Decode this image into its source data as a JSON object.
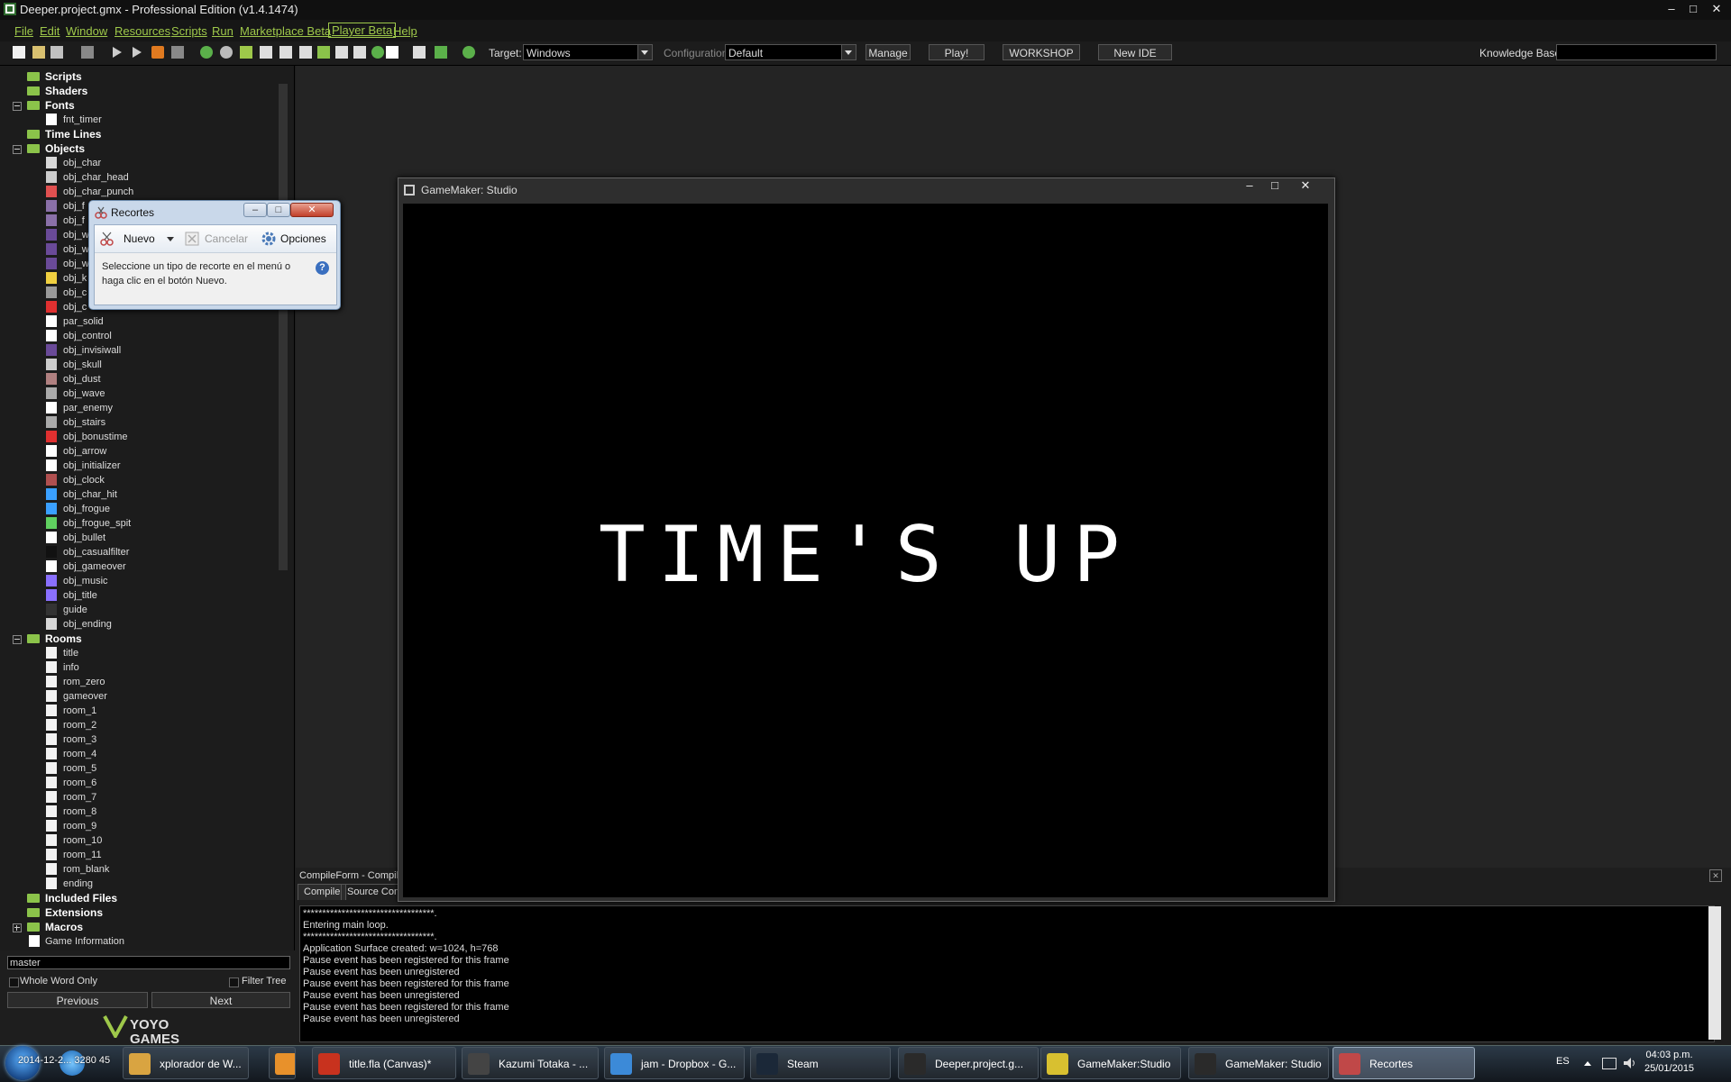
{
  "window": {
    "title": "Deeper.project.gmx  -  Professional Edition (v1.4.1474)",
    "minimize": "–",
    "maximize": "□",
    "close": "✕"
  },
  "menubar": [
    "File",
    "Edit",
    "Window",
    "Resources",
    "Scripts",
    "Run",
    "Marketplace Beta",
    "Player Beta",
    "Help"
  ],
  "toolbar": {
    "target_label": "Target:",
    "target_value": "Windows",
    "config_label": "Configuration:",
    "config_value": "Default",
    "manage": "Manage",
    "play": "Play!",
    "workshop": "WORKSHOP",
    "new_ide": "New IDE",
    "kb_label": "Knowledge Base:"
  },
  "tree": {
    "folders_top": [
      "Scripts",
      "Shaders"
    ],
    "fonts_label": "Fonts",
    "fonts": [
      "fnt_timer"
    ],
    "timelines_label": "Time Lines",
    "objects_label": "Objects",
    "objects": [
      "obj_char",
      "obj_char_head",
      "obj_char_punch",
      "obj_f",
      "obj_f",
      "obj_w",
      "obj_w",
      "obj_w",
      "obj_k",
      "obj_c",
      "obj_c",
      "par_solid",
      "obj_control",
      "obj_invisiwall",
      "obj_skull",
      "obj_dust",
      "obj_wave",
      "par_enemy",
      "obj_stairs",
      "obj_bonustime",
      "obj_arrow",
      "obj_initializer",
      "obj_clock",
      "obj_char_hit",
      "obj_frogue",
      "obj_frogue_spit",
      "obj_bullet",
      "obj_casualfilter",
      "obj_gameover",
      "obj_music",
      "obj_title",
      "guide",
      "obj_ending"
    ],
    "rooms_label": "Rooms",
    "rooms": [
      "title",
      "info",
      "rom_zero",
      "gameover",
      "room_1",
      "room_2",
      "room_3",
      "room_4",
      "room_5",
      "room_6",
      "room_7",
      "room_8",
      "room_9",
      "room_10",
      "room_11",
      "rom_blank",
      "ending"
    ],
    "bottom_folders": [
      "Included Files",
      "Extensions",
      "Macros"
    ],
    "game_info": "Game Information"
  },
  "filter": {
    "value": "master",
    "whole_word": "Whole Word Only",
    "filter_tree": "Filter Tree",
    "previous": "Previous",
    "next": "Next",
    "brand": "YOYO GAMES"
  },
  "snipping": {
    "title": "Recortes",
    "new": "Nuevo",
    "cancel": "Cancelar",
    "options": "Opciones",
    "message": "Seleccione un tipo de recorte en el menú o haga clic en el botón Nuevo.",
    "help": "?"
  },
  "game_window": {
    "title": "GameMaker: Studio",
    "text": "TIME'S UP"
  },
  "compile": {
    "title": "CompileForm - Compile",
    "tabs": [
      "Compile",
      "Source Con"
    ],
    "log": [
      "**********************************.",
      "Entering main loop.",
      "**********************************.",
      "Application Surface created: w=1024, h=768",
      "Pause event has been registered for this frame",
      "Pause event has been unregistered",
      "Pause event has been registered for this frame",
      "Pause event has been unregistered",
      "Pause event has been registered for this frame",
      "Pause event has been unregistered"
    ]
  },
  "taskbar": {
    "items": [
      {
        "label": "xplorador de W...",
        "icon": "folder-icon",
        "color": "#d9a441"
      },
      {
        "label": "",
        "icon": "media-player-icon",
        "color": "#e8912b"
      },
      {
        "label": "title.fla (Canvas)*",
        "icon": "flash-icon",
        "color": "#c8321e"
      },
      {
        "label": "Kazumi Totaka - ...",
        "icon": "music-player-icon",
        "color": "#444444"
      },
      {
        "label": "jam - Dropbox - G...",
        "icon": "chrome-icon",
        "color": "#3c8ad8"
      },
      {
        "label": "Steam",
        "icon": "steam-icon",
        "color": "#1b2838"
      },
      {
        "label": "Deeper.project.g...",
        "icon": "gamemaker-icon",
        "color": "#2a2a2a"
      },
      {
        "label": "GameMaker:Studio",
        "icon": "gamemaker-help-icon",
        "color": "#d8c030"
      },
      {
        "label": "GameMaker: Studio",
        "icon": "gamemaker-icon",
        "color": "#2a2a2a"
      },
      {
        "label": "Recortes",
        "icon": "snipping-icon",
        "color": "#c04848"
      }
    ],
    "lang": "ES",
    "time": "04:03 p.m.",
    "date": "25/01/2015",
    "overlay": "2014-12-2... 3280 45"
  }
}
